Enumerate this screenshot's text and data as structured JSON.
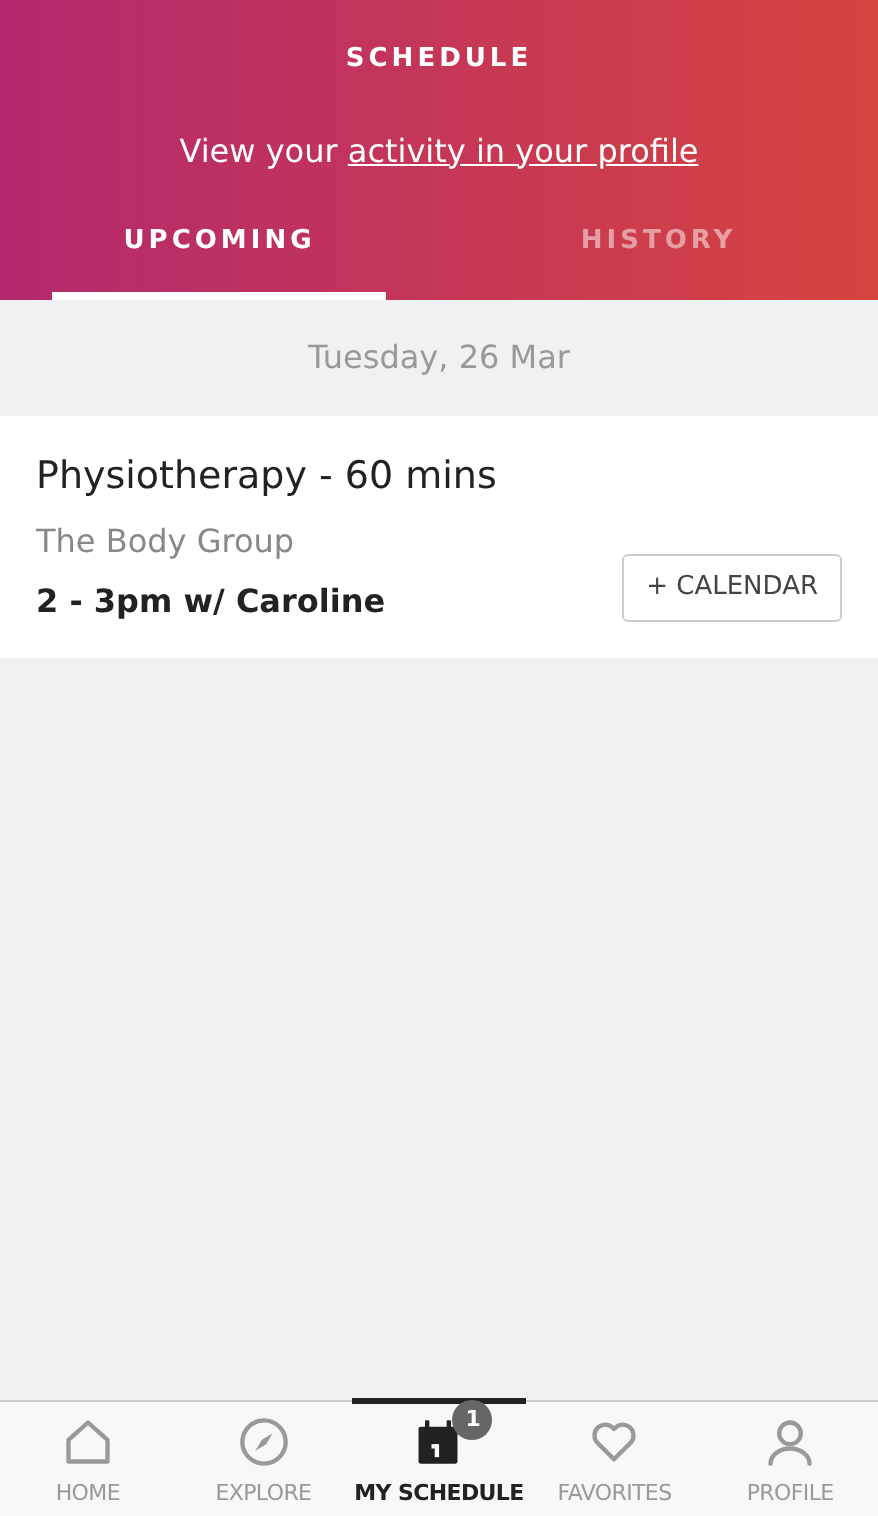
{
  "header": {
    "title": "SCHEDULE",
    "prompt": "View your",
    "prompt_link": "activity in your profile"
  },
  "tabs": [
    {
      "label": "UPCOMING",
      "selected": true
    },
    {
      "label": "HISTORY",
      "selected": false
    }
  ],
  "date": "Tuesday, 26 Mar",
  "appointments": [
    {
      "title": "Physiotherapy - 60 mins",
      "place": "The Body Group",
      "time": "2 - 3pm w/ Caroline",
      "action": "+ CALENDAR"
    }
  ],
  "nav": [
    {
      "label": "HOME",
      "kind": "home",
      "selected": false
    },
    {
      "label": "EXPLORE",
      "kind": "explore",
      "selected": false
    },
    {
      "label": "MY SCHEDULE",
      "kind": "schedule",
      "selected": true,
      "badge": "1"
    },
    {
      "label": "FAVORITES",
      "kind": "favorites",
      "selected": false
    },
    {
      "label": "PROFILE",
      "kind": "profile",
      "selected": false
    }
  ]
}
